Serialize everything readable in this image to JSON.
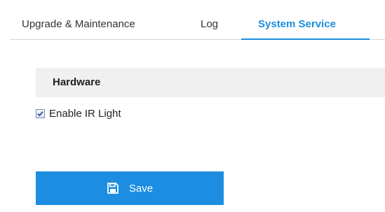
{
  "tabs": [
    {
      "label": "Upgrade & Maintenance",
      "active": false
    },
    {
      "label": "Log",
      "active": false
    },
    {
      "label": "System Service",
      "active": true
    }
  ],
  "section": {
    "title": "Hardware"
  },
  "options": {
    "enable_ir_light": {
      "label": "Enable IR Light",
      "checked": true
    }
  },
  "actions": {
    "save_label": "Save",
    "save_icon": "floppy-disk-icon"
  },
  "colors": {
    "accent": "#1c8de0",
    "section_bg": "#f0f0f0",
    "text": "#222222"
  }
}
